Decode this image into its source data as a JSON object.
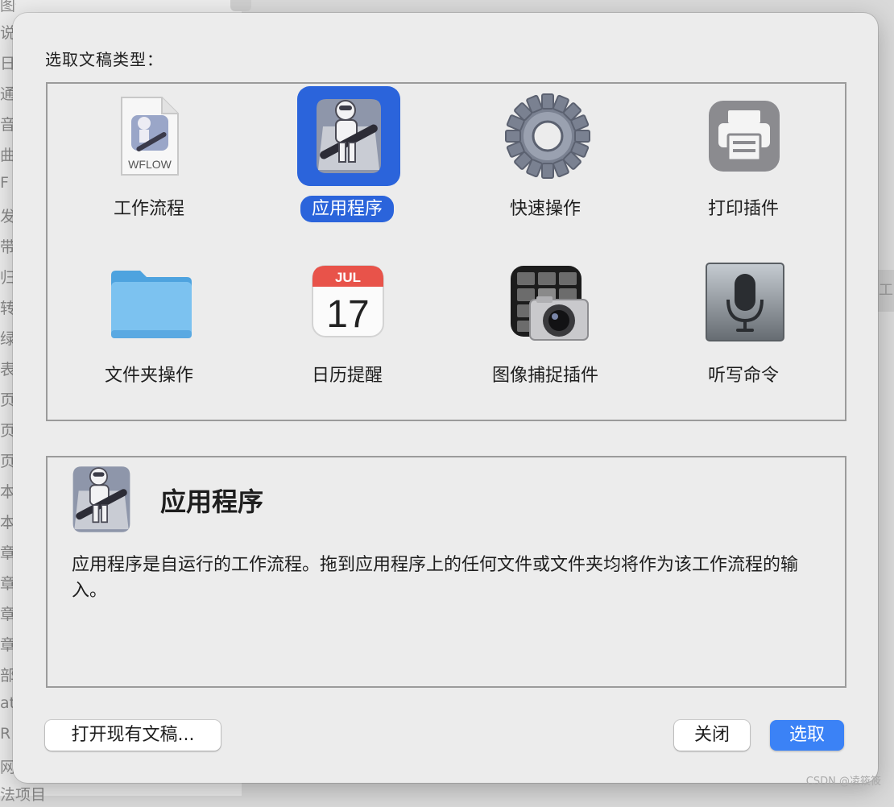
{
  "background": {
    "left_fragments": [
      "图像",
      "说",
      "日",
      "通",
      "音",
      "曲",
      "F",
      "发",
      "带",
      "归",
      "转",
      "绿",
      "表",
      "页",
      "页",
      "页",
      "本",
      "本",
      "章",
      "章",
      "章",
      "章",
      "部",
      "at",
      "R",
      "网",
      "法项目"
    ],
    "right_fragment": "工"
  },
  "dialog": {
    "title": "选取文稿类型：",
    "types": [
      {
        "label": "工作流程",
        "icon": "automator-workflow-file-icon",
        "badge": "WFLOW",
        "selected": false
      },
      {
        "label": "应用程序",
        "icon": "automator-robot-app-icon",
        "selected": true
      },
      {
        "label": "快速操作",
        "icon": "gear-icon",
        "selected": false
      },
      {
        "label": "打印插件",
        "icon": "printer-icon",
        "selected": false
      },
      {
        "label": "文件夹操作",
        "icon": "folder-icon",
        "selected": false
      },
      {
        "label": "日历提醒",
        "icon": "calendar-icon",
        "calendar_month": "JUL",
        "calendar_day": "17",
        "selected": false
      },
      {
        "label": "图像捕捉插件",
        "icon": "image-capture-icon",
        "selected": false
      },
      {
        "label": "听写命令",
        "icon": "microphone-icon",
        "selected": false
      }
    ],
    "description": {
      "title": "应用程序",
      "text": "应用程序是自运行的工作流程。拖到应用程序上的任何文件或文件夹均将作为该工作流程的输入。"
    },
    "buttons": {
      "open_existing": "打开现有文稿...",
      "close": "关闭",
      "choose": "选取"
    }
  },
  "watermark": "CSDN @凌筱筱",
  "colors": {
    "accent": "#2b64db",
    "primary_button": "#3b82f6",
    "sheet_background": "#ececec"
  }
}
